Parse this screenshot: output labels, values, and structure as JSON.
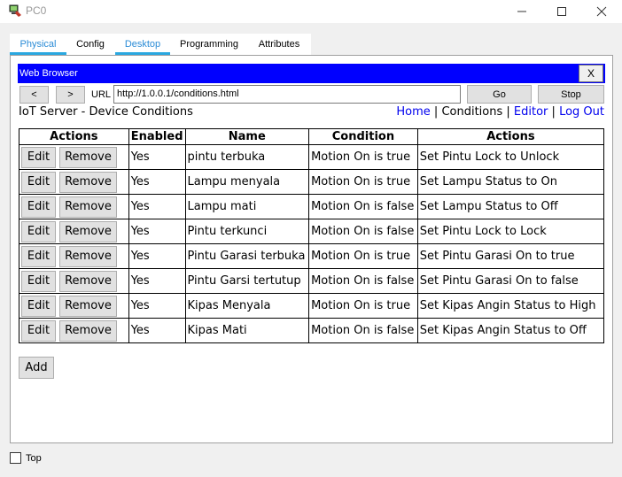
{
  "window": {
    "title": "PC0",
    "icon": "packet-tracer-pc-icon",
    "controls": {
      "minimize": "—",
      "maximize": "☐",
      "close": "✕"
    }
  },
  "tabs": [
    {
      "label": "Physical",
      "active": true
    },
    {
      "label": "Config",
      "active": false
    },
    {
      "label": "Desktop",
      "active": true
    },
    {
      "label": "Programming",
      "active": false
    },
    {
      "label": "Attributes",
      "active": false
    }
  ],
  "browser": {
    "title": "Web Browser",
    "close_label": "X",
    "back_label": "<",
    "forward_label": ">",
    "url_label": "URL",
    "url_value": "http://1.0.0.1/conditions.html",
    "go_label": "Go",
    "stop_label": "Stop"
  },
  "page": {
    "heading": "IoT Server - Device Conditions",
    "nav": {
      "home": "Home",
      "conditions": "Conditions",
      "editor": "Editor",
      "logout": "Log Out",
      "separator": "|"
    },
    "table": {
      "headers": [
        "Actions",
        "Enabled",
        "Name",
        "Condition",
        "Actions"
      ],
      "edit_label": "Edit",
      "remove_label": "Remove",
      "rows": [
        {
          "enabled": "Yes",
          "name": "pintu terbuka",
          "condition": "Motion On is true",
          "action": "Set Pintu Lock to Unlock"
        },
        {
          "enabled": "Yes",
          "name": "Lampu menyala",
          "condition": "Motion On is true",
          "action": "Set Lampu Status to On"
        },
        {
          "enabled": "Yes",
          "name": "Lampu mati",
          "condition": "Motion On is false",
          "action": "Set Lampu Status to Off"
        },
        {
          "enabled": "Yes",
          "name": "Pintu terkunci",
          "condition": "Motion On is false",
          "action": "Set Pintu Lock to Lock"
        },
        {
          "enabled": "Yes",
          "name": "Pintu Garasi terbuka",
          "condition": "Motion On is true",
          "action": "Set Pintu Garasi On to true"
        },
        {
          "enabled": "Yes",
          "name": "Pintu Garsi tertutup",
          "condition": "Motion On is false",
          "action": "Set Pintu Garasi On to false"
        },
        {
          "enabled": "Yes",
          "name": "Kipas Menyala",
          "condition": "Motion On is true",
          "action": "Set Kipas Angin Status to High"
        },
        {
          "enabled": "Yes",
          "name": "Kipas Mati",
          "condition": "Motion On is false",
          "action": "Set Kipas Angin Status to Off"
        }
      ]
    },
    "add_label": "Add"
  },
  "footer": {
    "top_label": "Top",
    "top_checked": false
  },
  "colors": {
    "browser_titlebar": "#0000ff",
    "link": "#0000ee",
    "active_tab": "#2aa8e0"
  }
}
